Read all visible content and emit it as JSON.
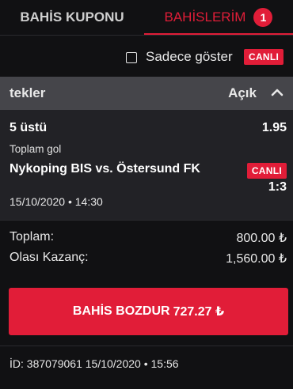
{
  "tabs": {
    "coupon_label": "BAHİS KUPONU",
    "mybets_label": "BAHİSLERİM",
    "mybets_count": "1"
  },
  "filter": {
    "label": "Sadece göster",
    "badge": "CANLI",
    "checked": false
  },
  "section": {
    "title": "tekler",
    "state": "Açık"
  },
  "bet": {
    "selection": "5 üstü",
    "odds": "1.95",
    "market": "Toplam gol",
    "match": "Nykoping BIS vs. Östersund FK",
    "live_badge": "CANLI",
    "score": "1:3",
    "datetime": "15/10/2020 • 14:30"
  },
  "totals": {
    "stake_label": "Toplam:",
    "stake_value": "800.00 ₺",
    "win_label": "Olası Kazanç:",
    "win_value": "1,560.00 ₺"
  },
  "cashout": {
    "label": "BAHİS BOZDUR",
    "amount": "727.27 ₺"
  },
  "footer": {
    "bet_id": "İD: 387079061  15/10/2020 • 15:56"
  },
  "colors": {
    "accent": "#e11d38",
    "background": "#111113",
    "card": "#222226",
    "section_header": "#45454a"
  }
}
